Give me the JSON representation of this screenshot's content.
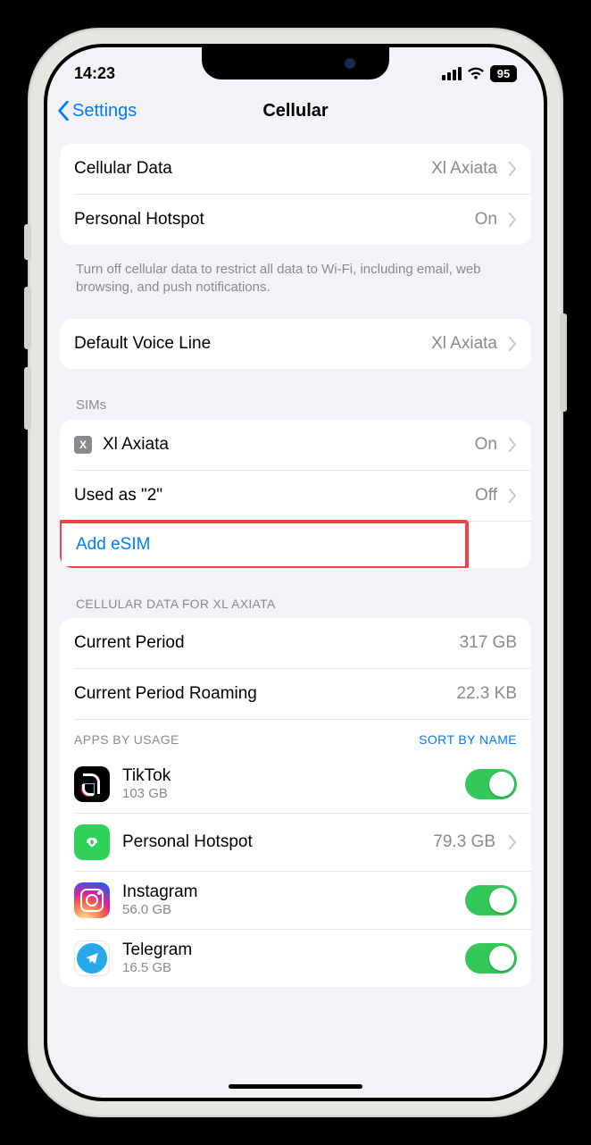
{
  "status": {
    "time": "14:23",
    "battery": "95"
  },
  "nav": {
    "back": "Settings",
    "title": "Cellular"
  },
  "section1": {
    "cellular_data_label": "Cellular Data",
    "cellular_data_value": "Xl Axiata",
    "hotspot_label": "Personal Hotspot",
    "hotspot_value": "On",
    "footer": "Turn off cellular data to restrict all data to Wi-Fi, including email, web browsing, and push notifications."
  },
  "section2": {
    "voice_label": "Default Voice Line",
    "voice_value": "Xl Axiata"
  },
  "sims": {
    "header": "SIMs",
    "badge": "X",
    "sim1_label": "Xl Axiata",
    "sim1_value": "On",
    "sim2_label": "Used as \"2\"",
    "sim2_value": "Off",
    "add_label": "Add eSIM"
  },
  "data_section": {
    "header": "CELLULAR DATA FOR XL AXIATA",
    "period_label": "Current Period",
    "period_value": "317 GB",
    "roaming_label": "Current Period Roaming",
    "roaming_value": "22.3 KB",
    "apps_header": "APPS BY USAGE",
    "sort_label": "SORT BY NAME",
    "apps": {
      "tiktok": {
        "name": "TikTok",
        "usage": "103 GB"
      },
      "hotspot": {
        "name": "Personal Hotspot",
        "usage": "79.3 GB"
      },
      "instagram": {
        "name": "Instagram",
        "usage": "56.0 GB"
      },
      "telegram": {
        "name": "Telegram",
        "usage": "16.5 GB"
      }
    }
  }
}
